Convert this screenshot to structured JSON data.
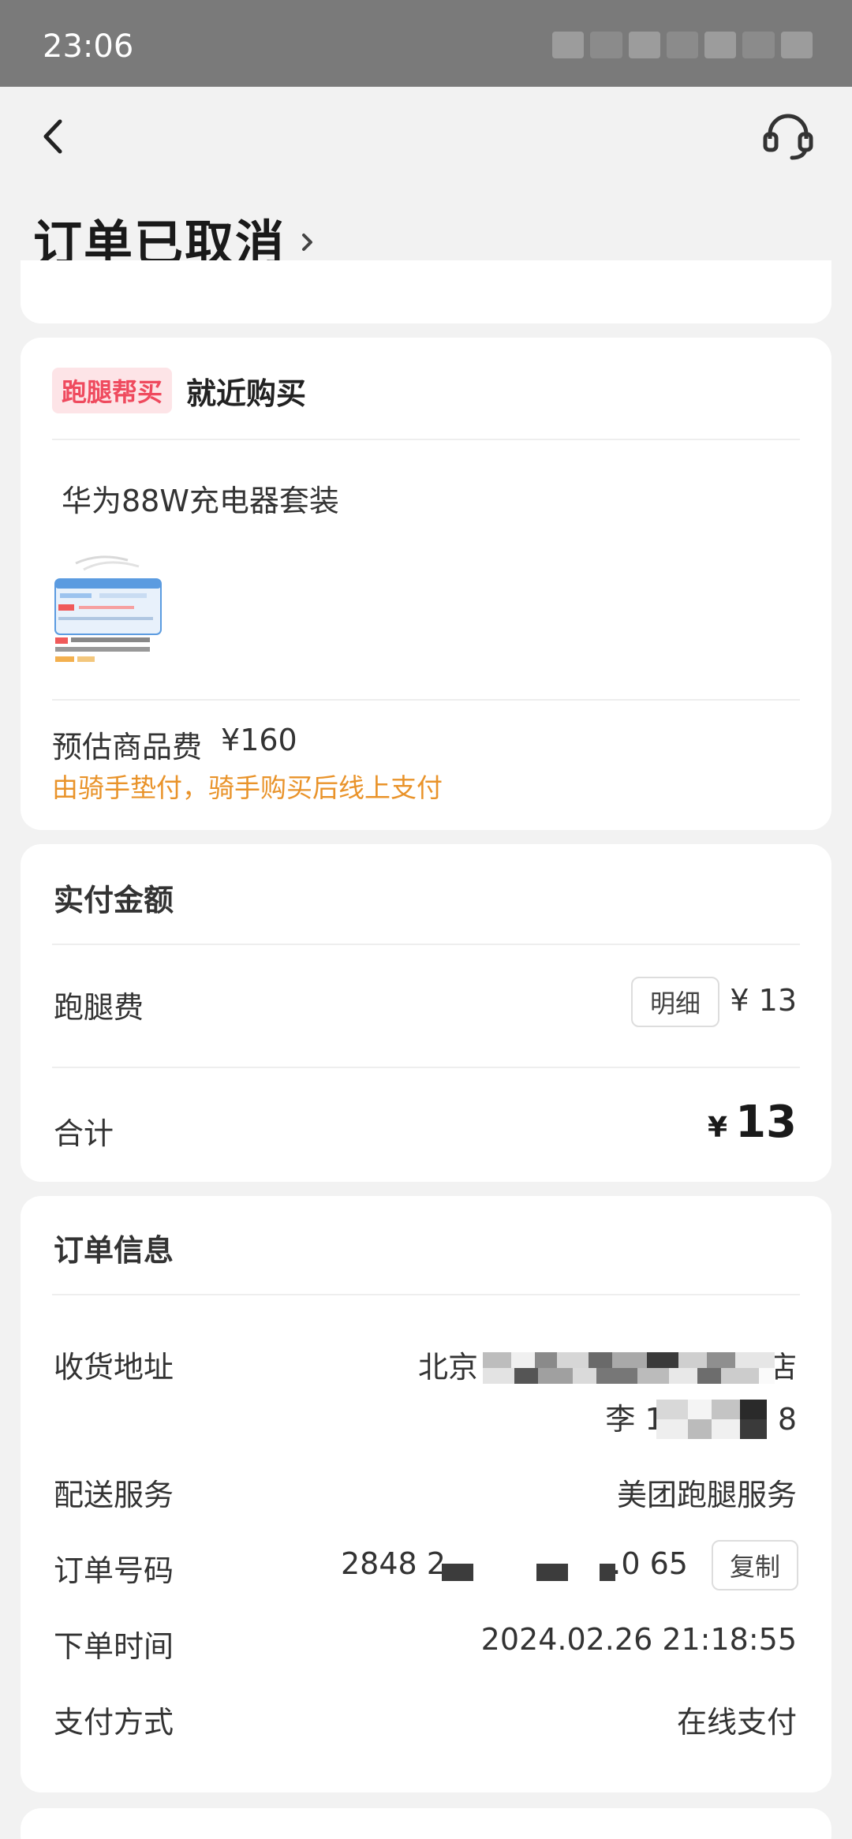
{
  "status_bar": {
    "time": "23:06"
  },
  "header": {
    "title": "订单已取消"
  },
  "errand": {
    "tag": "跑腿帮买",
    "type": "就近购买",
    "product_name": "华为88W充电器套装",
    "fee_label": "预估商品费",
    "fee_value": "¥160",
    "fee_note": "由骑手垫付，骑手购买后线上支付"
  },
  "payment": {
    "title": "实付金额",
    "errand_fee_label": "跑腿费",
    "detail_button": "明细",
    "errand_fee_value": "¥ 13",
    "total_label": "合计",
    "total_currency": "¥",
    "total_value": "13"
  },
  "order_info": {
    "title": "订单信息",
    "address_label": "收货地址",
    "address_line1_start": "北京",
    "address_line1_end": "酒店",
    "address_line2_start": "李 17",
    "address_line2_end": "8",
    "delivery_label": "配送服务",
    "delivery_value": "美团跑腿服务",
    "order_no_label": "订单号码",
    "order_no_start": "2848 2",
    "order_no_end": ".0 65",
    "copy_button": "复制",
    "time_label": "下单时间",
    "time_value": "2024.02.26 21:18:55",
    "pay_method_label": "支付方式",
    "pay_method_value": "在线支付"
  },
  "colors": {
    "tag_bg": "#fde4e7",
    "tag_text": "#ef4a5e",
    "note_text": "#e9932a",
    "status_bar": "#7a7a7a"
  }
}
